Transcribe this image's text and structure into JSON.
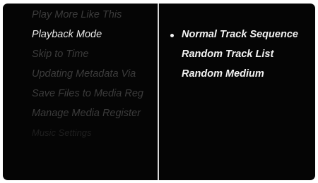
{
  "left_menu": {
    "items": [
      {
        "label": "Play More Like This",
        "state": "disabled"
      },
      {
        "label": "Playback Mode",
        "state": "active"
      },
      {
        "label": "Skip to Time",
        "state": "disabled"
      },
      {
        "label": "Updating Metadata Via",
        "state": "disabled"
      },
      {
        "label": "Save Files to Media Reg",
        "state": "disabled"
      },
      {
        "label": "Manage Media Register",
        "state": "disabled"
      },
      {
        "label": "Music Settings",
        "state": "faint"
      }
    ]
  },
  "right_list": {
    "selected_index": 0,
    "options": [
      {
        "label": "Normal Track Sequence"
      },
      {
        "label": "Random Track List"
      },
      {
        "label": "Random Medium"
      }
    ]
  },
  "colors": {
    "screen_bg": "#050505",
    "active_text": "#e9e9e9",
    "disabled_text": "#3c3c3c",
    "divider": "#d8d8d8"
  }
}
